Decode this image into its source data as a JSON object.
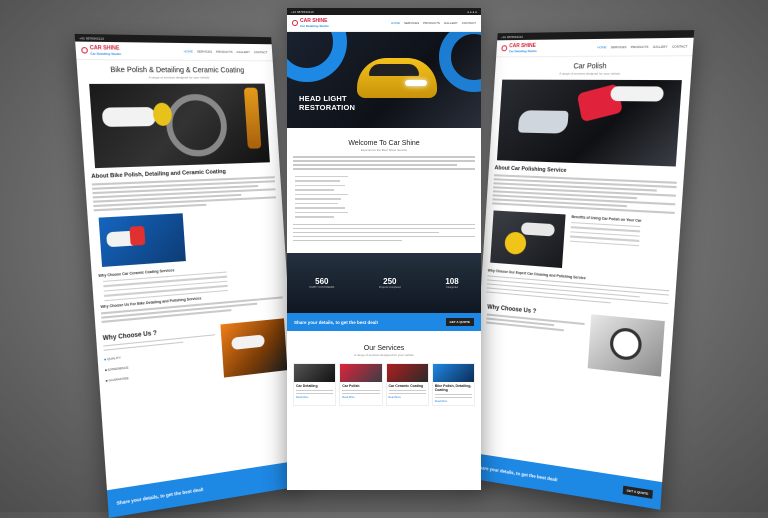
{
  "site": {
    "top_left": "+91 9876543210",
    "logo_name": "CAR SHINE",
    "logo_tag": "Car Detailing Studio",
    "menu": [
      "HOME",
      "SERVICES",
      "PRODUCTS",
      "GALLERY",
      "CONTACT"
    ]
  },
  "left_page": {
    "title": "Bike Polish & Detailing & Ceramic Coating",
    "tagline": "A range of services designed for your vehicle",
    "about_heading": "About Bike Polish, Detailing and Ceramic Coating",
    "why_choose_small": "Why Choose Car Ceramic Coating Services",
    "why_choose2_small": "Why Choose Us For Bike Detailing and Polishing Services",
    "why_heading": "Why Choose Us ?",
    "items": [
      "QUALITY",
      "EXPERIENCE",
      "GUARANTEE"
    ],
    "cta_text": "Share your details, to get the best deal!",
    "cta_button": "GET A QUOTE"
  },
  "center_page": {
    "hero_title_1": "HEAD LIGHT",
    "hero_title_2": "RESTORATION",
    "welcome": "Welcome To Car Shine",
    "welcome_tag": "Experience the Best Shine Service",
    "stats": [
      {
        "value": "560",
        "label": "HAPPY CUSTOMERS"
      },
      {
        "value": "250",
        "label": "Projects Completed"
      },
      {
        "value": "108",
        "label": "Categories"
      }
    ],
    "cta_text": "Share your details, to get the best deal!",
    "cta_button": "GET A QUOTE",
    "services_title": "Our Services",
    "services_tag": "A range of services designed for your vehicle",
    "services": [
      {
        "name": "Car Detailing",
        "more": "Read More"
      },
      {
        "name": "Car Polish",
        "more": "Read More"
      },
      {
        "name": "Car Ceramic Coating",
        "more": "Read More"
      },
      {
        "name": "Bike Polish, Detailing, Coating",
        "more": "Read More"
      }
    ]
  },
  "right_page": {
    "title": "Car Polish",
    "tagline": "A range of services designed for your vehicle",
    "about_heading": "About Car Polishing Service",
    "benefits": "Benefits of Using Car Polish on Your Car",
    "choose_small": "Why Choose Our Expert Car Cleaning and Polishing Service",
    "why_heading": "Why Choose Us ?",
    "cta_text": "Share your details, to get the best deal!",
    "cta_button": "GET A QUOTE"
  },
  "colors": {
    "accent": "#1e88e5",
    "brand": "#d6223a",
    "dark": "#1b1b1b"
  }
}
